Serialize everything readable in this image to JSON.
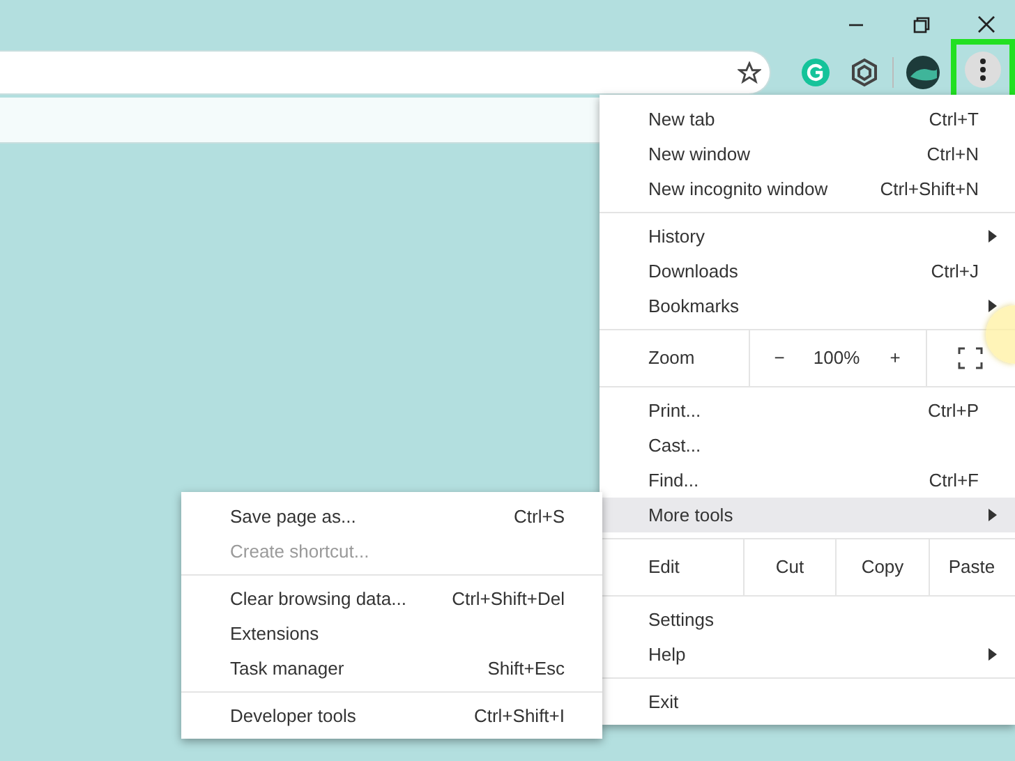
{
  "menu_button": {
    "outlined": true
  },
  "menu": {
    "sections": [
      {
        "items": [
          {
            "kind": "item",
            "label": "New tab",
            "shortcut": "Ctrl+T",
            "has_submenu": false,
            "selected": false
          },
          {
            "kind": "item",
            "label": "New window",
            "shortcut": "Ctrl+N",
            "has_submenu": false,
            "selected": false
          },
          {
            "kind": "item",
            "label": "New incognito window",
            "shortcut": "Ctrl+Shift+N",
            "has_submenu": false,
            "selected": false
          }
        ]
      },
      {
        "items": [
          {
            "kind": "item",
            "label": "History",
            "has_submenu": true,
            "selected": false
          },
          {
            "kind": "item",
            "label": "Downloads",
            "shortcut": "Ctrl+J",
            "has_submenu": false,
            "selected": false
          },
          {
            "kind": "item",
            "label": "Bookmarks",
            "has_submenu": true,
            "selected": false
          }
        ]
      },
      {
        "items": [
          {
            "kind": "zoom",
            "label": "Zoom",
            "minus": "−",
            "value": "100%",
            "plus": "+"
          }
        ]
      },
      {
        "items": [
          {
            "kind": "item",
            "label": "Print...",
            "shortcut": "Ctrl+P",
            "has_submenu": false,
            "selected": false
          },
          {
            "kind": "item",
            "label": "Cast...",
            "has_submenu": false,
            "selected": false
          },
          {
            "kind": "item",
            "label": "Find...",
            "shortcut": "Ctrl+F",
            "has_submenu": false,
            "selected": false
          },
          {
            "kind": "item",
            "label": "More tools",
            "has_submenu": true,
            "selected": true
          }
        ]
      },
      {
        "items": [
          {
            "kind": "edit",
            "label": "Edit",
            "buttons": [
              "Cut",
              "Copy",
              "Paste"
            ]
          }
        ]
      },
      {
        "items": [
          {
            "kind": "item",
            "label": "Settings",
            "has_submenu": false,
            "selected": false
          },
          {
            "kind": "item",
            "label": "Help",
            "has_submenu": true,
            "selected": false
          }
        ]
      },
      {
        "items": [
          {
            "kind": "item",
            "label": "Exit",
            "has_submenu": false,
            "selected": false
          }
        ]
      }
    ]
  },
  "submenu": {
    "sections": [
      {
        "items": [
          {
            "label": "Save page as...",
            "shortcut": "Ctrl+S",
            "disabled": false
          },
          {
            "label": "Create shortcut...",
            "disabled": true
          }
        ]
      },
      {
        "items": [
          {
            "label": "Clear browsing data...",
            "shortcut": "Ctrl+Shift+Del",
            "disabled": false
          },
          {
            "label": "Extensions",
            "disabled": false
          },
          {
            "label": "Task manager",
            "shortcut": "Shift+Esc",
            "disabled": false
          }
        ]
      },
      {
        "items": [
          {
            "label": "Developer tools",
            "shortcut": "Ctrl+Shift+I",
            "disabled": false
          }
        ]
      }
    ]
  }
}
